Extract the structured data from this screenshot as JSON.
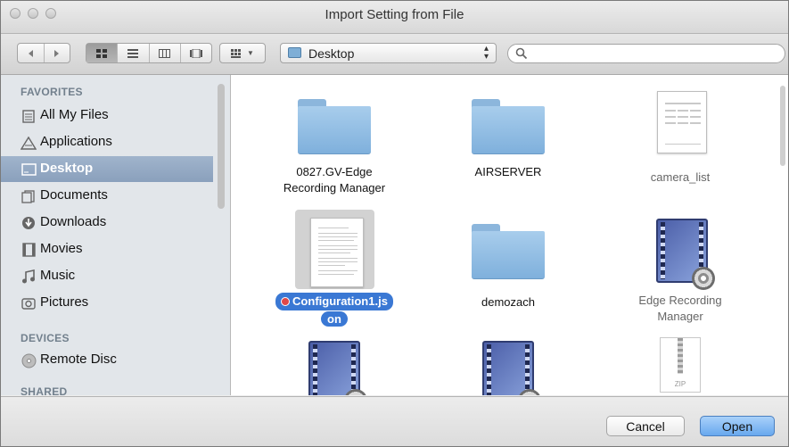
{
  "window": {
    "title": "Import Setting from File"
  },
  "toolbar": {
    "back_icon": "chevron-left-icon",
    "forward_icon": "chevron-right-icon",
    "view_icons": [
      "icon-view-icon",
      "list-view-icon",
      "column-view-icon",
      "coverflow-view-icon"
    ],
    "arrange_icon": "arrange-icon",
    "location": "Desktop",
    "search_placeholder": ""
  },
  "sidebar": {
    "sections": [
      {
        "title": "FAVORITES",
        "items": [
          {
            "label": "All My Files",
            "icon": "all-files-icon"
          },
          {
            "label": "Applications",
            "icon": "applications-icon"
          },
          {
            "label": "Desktop",
            "icon": "desktop-icon",
            "selected": true
          },
          {
            "label": "Documents",
            "icon": "documents-icon"
          },
          {
            "label": "Downloads",
            "icon": "downloads-icon"
          },
          {
            "label": "Movies",
            "icon": "movies-icon"
          },
          {
            "label": "Music",
            "icon": "music-icon"
          },
          {
            "label": "Pictures",
            "icon": "pictures-icon"
          }
        ]
      },
      {
        "title": "DEVICES",
        "items": [
          {
            "label": "Remote Disc",
            "icon": "remote-disc-icon"
          }
        ]
      },
      {
        "title": "SHARED",
        "items": []
      }
    ]
  },
  "files": [
    {
      "name_line1": "0827.GV-Edge",
      "name_line2": "Recording Manager",
      "kind": "folder",
      "enabled": true
    },
    {
      "name_line1": "AIRSERVER",
      "name_line2": "",
      "kind": "folder",
      "enabled": true
    },
    {
      "name_line1": "camera_list",
      "name_line2": "",
      "kind": "spreadsheet-document",
      "enabled": false
    },
    {
      "name_line1": "Configuration1.js",
      "name_line2": "on",
      "kind": "json-document",
      "enabled": true,
      "selected": true
    },
    {
      "name_line1": "demozach",
      "name_line2": "",
      "kind": "folder",
      "enabled": true
    },
    {
      "name_line1": "Edge Recording",
      "name_line2": "Manager",
      "kind": "movie-app",
      "enabled": false
    },
    {
      "name_line1": "",
      "name_line2": "",
      "kind": "movie-app",
      "enabled": false
    },
    {
      "name_line1": "",
      "name_line2": "",
      "kind": "movie-app",
      "enabled": false
    },
    {
      "name_line1": "",
      "name_line2": "",
      "kind": "zip-archive",
      "enabled": false,
      "icon_text": "ZIP"
    }
  ],
  "buttons": {
    "cancel": "Cancel",
    "open": "Open"
  },
  "colors": {
    "selection_pill": "#3a78d4",
    "sidebar_selection": "#8aa0bc",
    "primary_button": "#68a8ee",
    "folder": "#7fb0dc"
  }
}
